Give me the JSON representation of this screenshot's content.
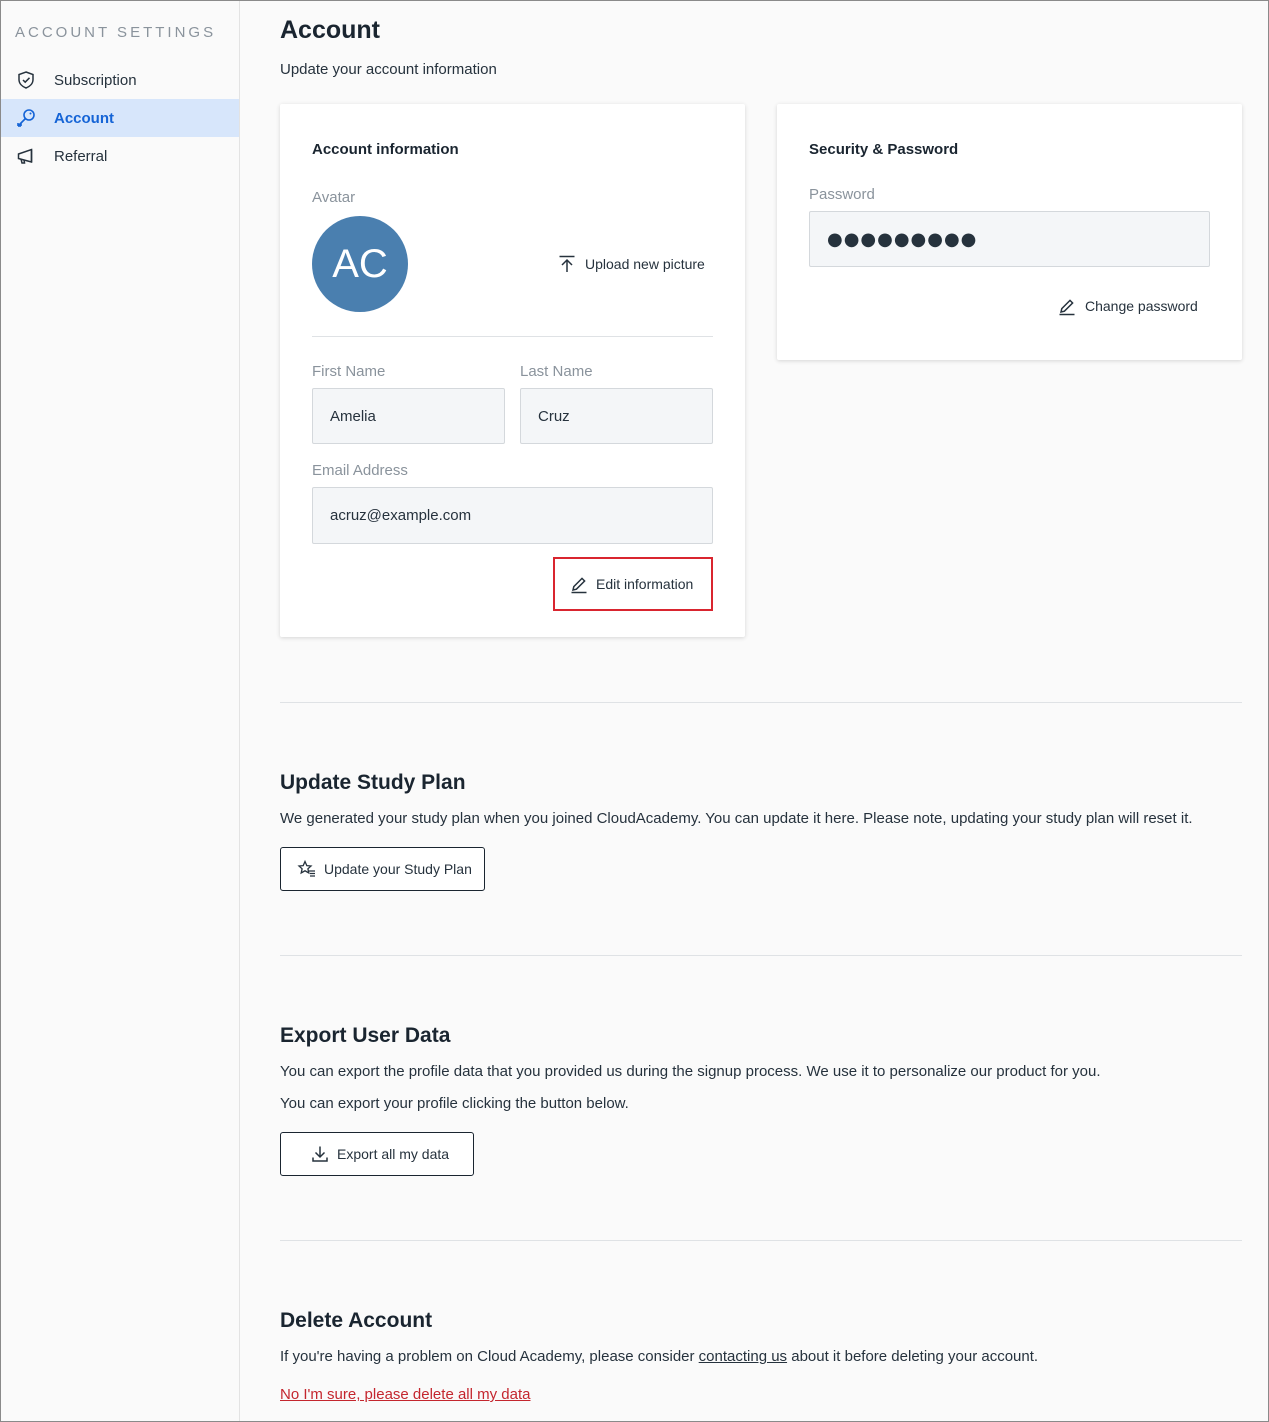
{
  "sidebar": {
    "title": "ACCOUNT SETTINGS",
    "items": [
      {
        "label": "Subscription",
        "icon": "shield-check-icon",
        "active": false
      },
      {
        "label": "Account",
        "icon": "key-icon",
        "active": true
      },
      {
        "label": "Referral",
        "icon": "megaphone-icon",
        "active": false
      }
    ]
  },
  "header": {
    "title": "Account",
    "subtitle": "Update your account information"
  },
  "account_info": {
    "title": "Account information",
    "avatar_label": "Avatar",
    "avatar_initials": "AC",
    "avatar_color": "#4a7faf",
    "upload_label": "Upload new picture",
    "first_name_label": "First Name",
    "first_name_value": "Amelia",
    "last_name_label": "Last Name",
    "last_name_value": "Cruz",
    "email_label": "Email Address",
    "email_value": "acruz@example.com",
    "edit_label": "Edit information"
  },
  "security": {
    "title": "Security & Password",
    "password_label": "Password",
    "password_value": "●●●●●●●●●",
    "change_label": "Change password"
  },
  "study_plan": {
    "title": "Update Study Plan",
    "text": "We generated your study plan when you joined CloudAcademy. You can update it here. Please note, updating your study plan will reset it.",
    "button_label": "Update your Study Plan"
  },
  "export": {
    "title": "Export User Data",
    "text1": "You can export the profile data that you provided us during the signup process. We use it to personalize our product for you.",
    "text2": "You can export your profile clicking the button below.",
    "button_label": "Export all my data"
  },
  "delete": {
    "title": "Delete Account",
    "text_before": "If you're having a problem on Cloud Academy, please consider ",
    "link_label": "contacting us",
    "text_after": " about it before deleting your account.",
    "danger_label": "No I'm sure, please delete all my data",
    "danger_color": "#c4262e"
  },
  "colors": {
    "accent": "#1564d6",
    "active_bg": "#d7e6fb",
    "highlight": "#d9252f"
  }
}
